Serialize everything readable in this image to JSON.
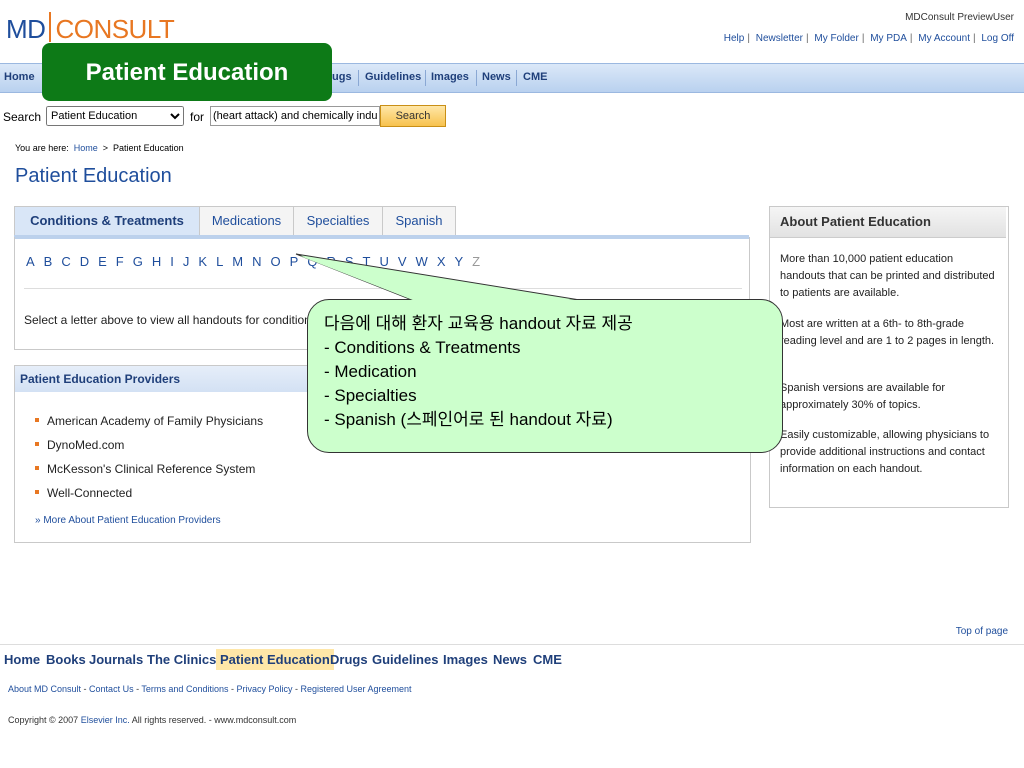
{
  "header": {
    "logo_md": "MD",
    "logo_consult": "CONSULT",
    "user": "MDConsult PreviewUser",
    "top_links": [
      "Help",
      "Newsletter",
      "My Folder",
      "My PDA",
      "My Account",
      "Log Off"
    ]
  },
  "nav": {
    "items": [
      "Home",
      "ugs",
      "Guidelines",
      "Images",
      "News",
      "CME"
    ]
  },
  "search": {
    "label": "Search",
    "scope": "Patient Education",
    "for_label": "for",
    "query": "(heart attack) and chemically indu",
    "button": "Search"
  },
  "breadcrumb": {
    "prefix": "You are here:",
    "home": "Home",
    "arrow": ">",
    "current": "Patient Education"
  },
  "page_title": "Patient Education",
  "tabs": [
    "Conditions & Treatments",
    "Medications",
    "Specialties",
    "Spanish"
  ],
  "letters": [
    "A",
    "B",
    "C",
    "D",
    "E",
    "F",
    "G",
    "H",
    "I",
    "J",
    "K",
    "L",
    "M",
    "N",
    "O",
    "P",
    "Q",
    "R",
    "S",
    "T",
    "U",
    "V",
    "W",
    "X",
    "Y",
    "Z"
  ],
  "select_message": "Select a letter above to view all handouts for conditions",
  "providers": {
    "title": "Patient Education Providers",
    "items": [
      "American Academy of Family Physicians",
      "DynoMed.com",
      "McKesson's Clinical Reference System",
      "Well-Connected"
    ],
    "more": "» More About Patient Education Providers"
  },
  "about": {
    "title": "About Patient Education",
    "p1": "More than 10,000 patient education handouts that can be printed and distributed to patients are available.",
    "p2": "Most are written at a 6th- to 8th-grade reading level and are 1 to 2 pages in length.",
    "p3": "Spanish versions are available for approximately 30% of topics.",
    "p4": "Easily customizable, allowing physicians to provide additional instructions and contact information on each handout."
  },
  "callout_badge": "Patient Education",
  "callout": {
    "line1": "다음에 대해 환자 교육용 handout 자료 제공",
    "line2": "- Conditions & Treatments",
    "line3": "- Medication",
    "line4": "- Specialties",
    "line5": "- Spanish (스페인어로 된 handout 자료)"
  },
  "footer": {
    "top_of_page": "Top of page",
    "nav": [
      "Home",
      "Books",
      "Journals",
      "The Clinics",
      "Patient Education",
      "Drugs",
      "Guidelines",
      "Images",
      "News",
      "CME"
    ],
    "links": [
      "About MD Consult",
      "Contact Us",
      "Terms and Conditions",
      "Privacy Policy",
      "Registered User Agreement"
    ],
    "copyright_prefix": "Copyright © 2007",
    "copyright_link": "Elsevier Inc.",
    "copyright_suffix": "All rights reserved. - www.mdconsult.com"
  },
  "colors": {
    "brand_blue": "#1f4e9c",
    "brand_orange": "#e87722",
    "callout_green": "#ccffcc",
    "badge_green": "#0d7a17"
  }
}
